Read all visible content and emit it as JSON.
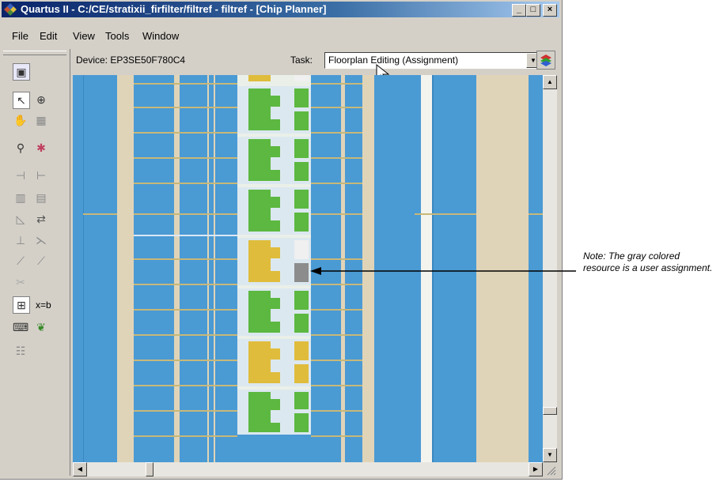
{
  "window": {
    "title": "Quartus II - C:/CE/stratixii_firfilter/filtref - filtref - [Chip Planner]",
    "controls": [
      "_",
      "□",
      "×"
    ]
  },
  "menu": [
    "File",
    "Edit",
    "View",
    "Tools",
    "Window"
  ],
  "infobar": {
    "device": "Device: EP3SE50F780C4",
    "task_label": "Task:",
    "task_value": "Floorplan Editing (Assignment)"
  },
  "toolbar_text": {
    "xb": "x=b"
  },
  "annotation": {
    "note": "Note: The gray colored resource is a user assignment."
  },
  "colors": {
    "canvas_blue": "#4a9ad4",
    "logic_green": "#5cb840",
    "assigned_yellow": "#e0bc3c",
    "user_assignment_gray": "#8c8c8c",
    "column_tan": "#e0d4b8"
  },
  "tools": [
    "chip-planner-icon",
    "select-pointer-icon",
    "zoom-icon",
    "hand-pan-icon",
    "grid-icon",
    "find-binoculars-icon",
    "bookmark-icon",
    "fanin-icon",
    "fanout-icon",
    "show-connections-icon",
    "routing-icon",
    "delay-icon",
    "critical-path-icon",
    "edit-icon",
    "expression-icon",
    "assignment-icon",
    "parrot-icon",
    "report-icon"
  ]
}
